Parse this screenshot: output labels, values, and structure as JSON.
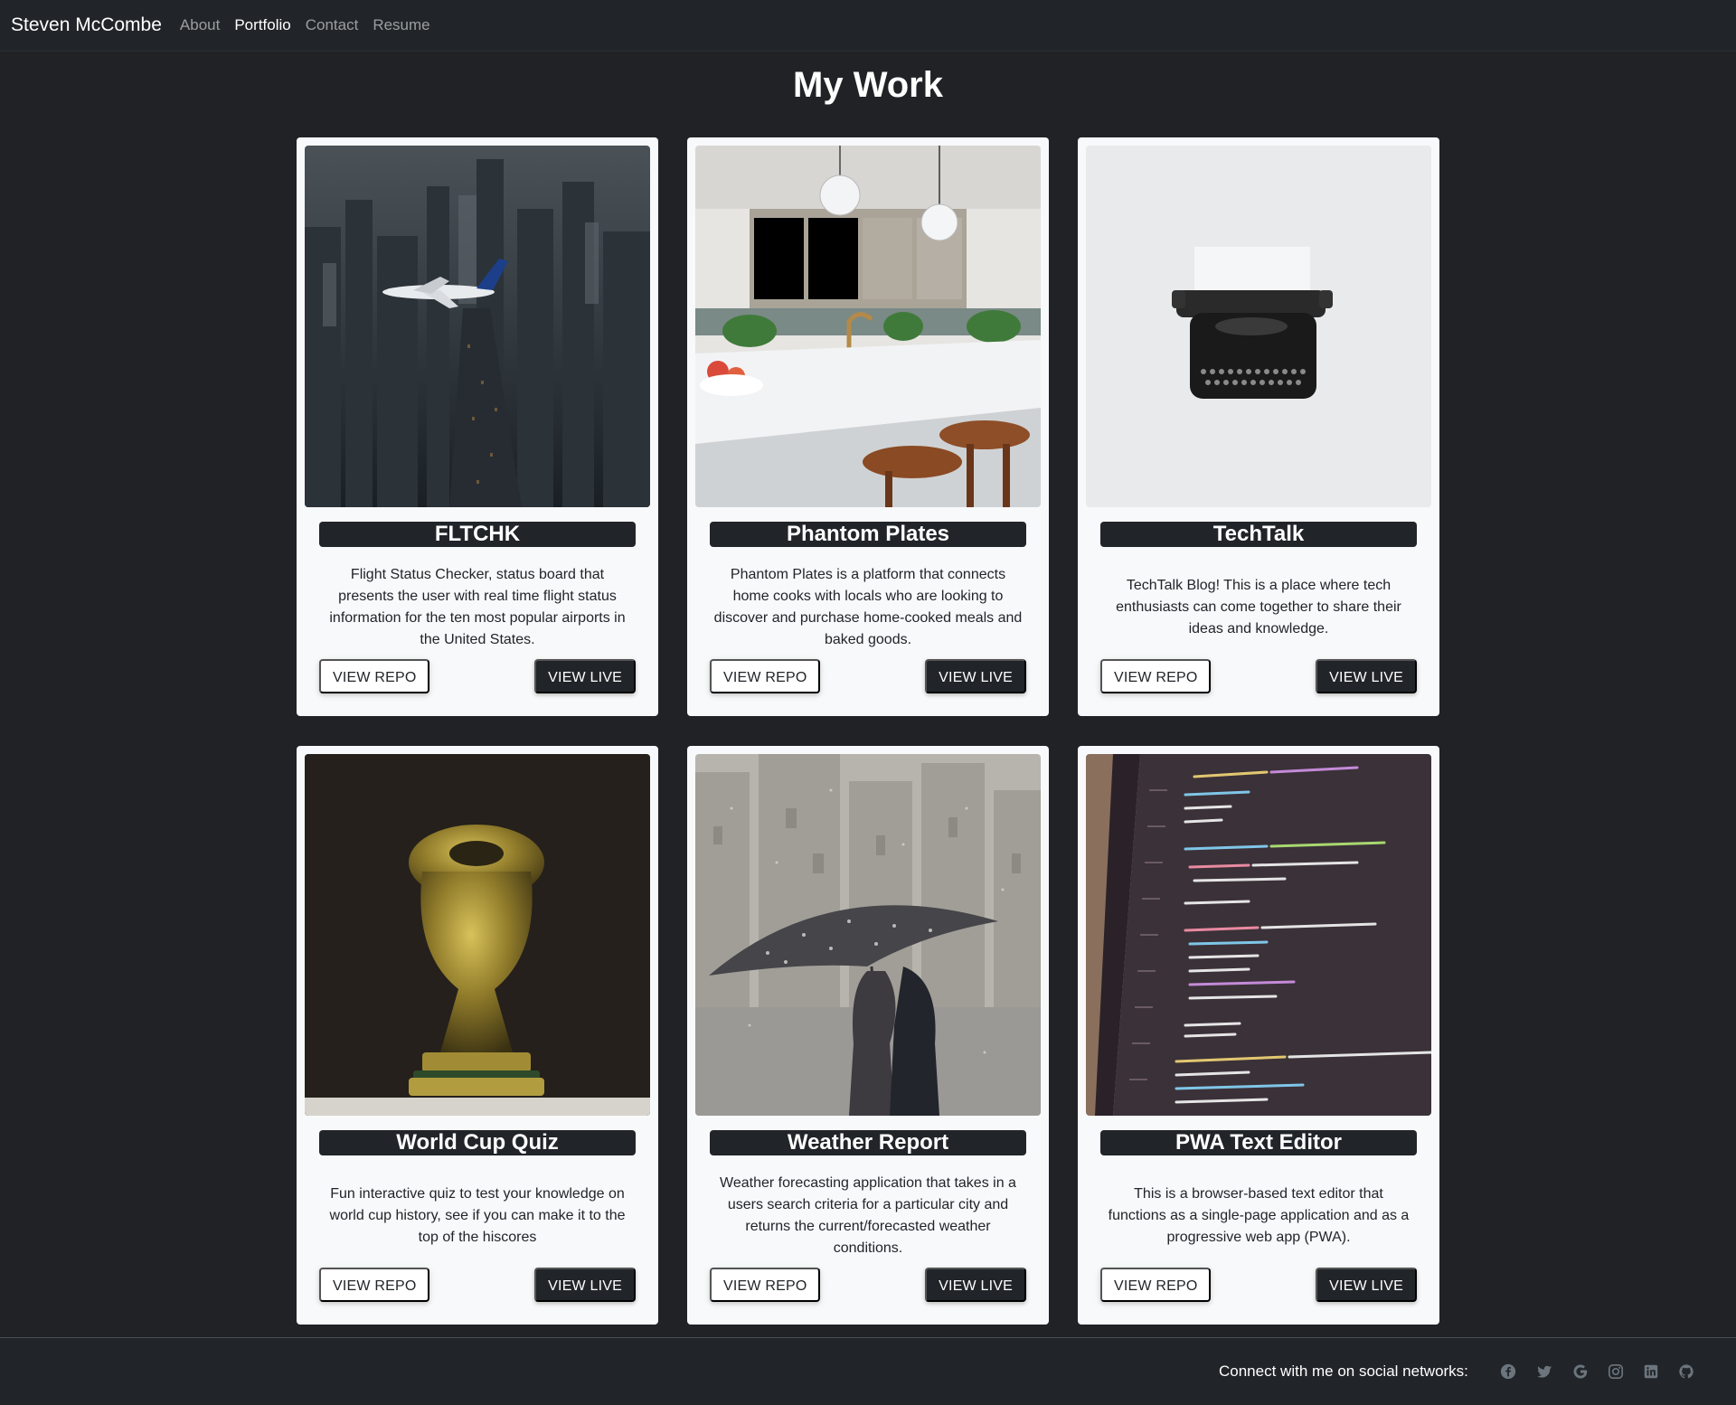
{
  "navbar": {
    "brand": "Steven McCombe",
    "links": [
      "About",
      "Portfolio",
      "Contact",
      "Resume"
    ],
    "active": "Portfolio"
  },
  "page": {
    "title": "My Work"
  },
  "projects": [
    {
      "title": "FLTCHK",
      "description": [
        "Flight Status Checker, status board that",
        "presents the user with real time flight status",
        "information for the ten most popular airports in",
        "the United States."
      ],
      "repo_label": "VIEW REPO",
      "live_label": "VIEW LIVE",
      "image": "city-with-airplane"
    },
    {
      "title": "Phantom Plates",
      "description": [
        "Phantom Plates is a platform that connects",
        "home cooks with locals who are looking to",
        "discover and purchase home-cooked meals and",
        "baked goods."
      ],
      "repo_label": "VIEW REPO",
      "live_label": "VIEW LIVE",
      "image": "kitchen"
    },
    {
      "title": "TechTalk",
      "description": [
        "TechTalk Blog! This is a place where tech",
        "enthusiasts can come together to share their",
        "ideas and knowledge."
      ],
      "repo_label": "VIEW REPO",
      "live_label": "VIEW LIVE",
      "image": "typewriter"
    },
    {
      "title": "World Cup Quiz",
      "description": [
        "Fun interactive quiz to test your knowledge on",
        "world cup history, see if you can make it to the",
        "top of the hiscores"
      ],
      "repo_label": "VIEW REPO",
      "live_label": "VIEW LIVE",
      "image": "world-cup-trophy"
    },
    {
      "title": "Weather Report",
      "description": [
        "Weather forecasting application that takes in a",
        "users search criteria for a particular city and",
        "returns the current/forecasted weather",
        "conditions."
      ],
      "repo_label": "VIEW REPO",
      "live_label": "VIEW LIVE",
      "image": "umbrella-snow"
    },
    {
      "title": "PWA Text Editor",
      "description": [
        "This is a browser-based text editor that",
        "functions as a single-page application and as a",
        "progressive web app (PWA)."
      ],
      "repo_label": "VIEW REPO",
      "live_label": "VIEW LIVE",
      "image": "code-screen"
    }
  ],
  "footer": {
    "text": "Connect with me on social networks:",
    "social_icons": [
      "facebook-icon",
      "twitter-icon",
      "google-icon",
      "instagram-icon",
      "linkedin-icon",
      "github-icon"
    ]
  },
  "colors": {
    "background": "#202226",
    "navbar": "#212529",
    "card": "#f8f9fa",
    "dark_button": "#212529"
  }
}
